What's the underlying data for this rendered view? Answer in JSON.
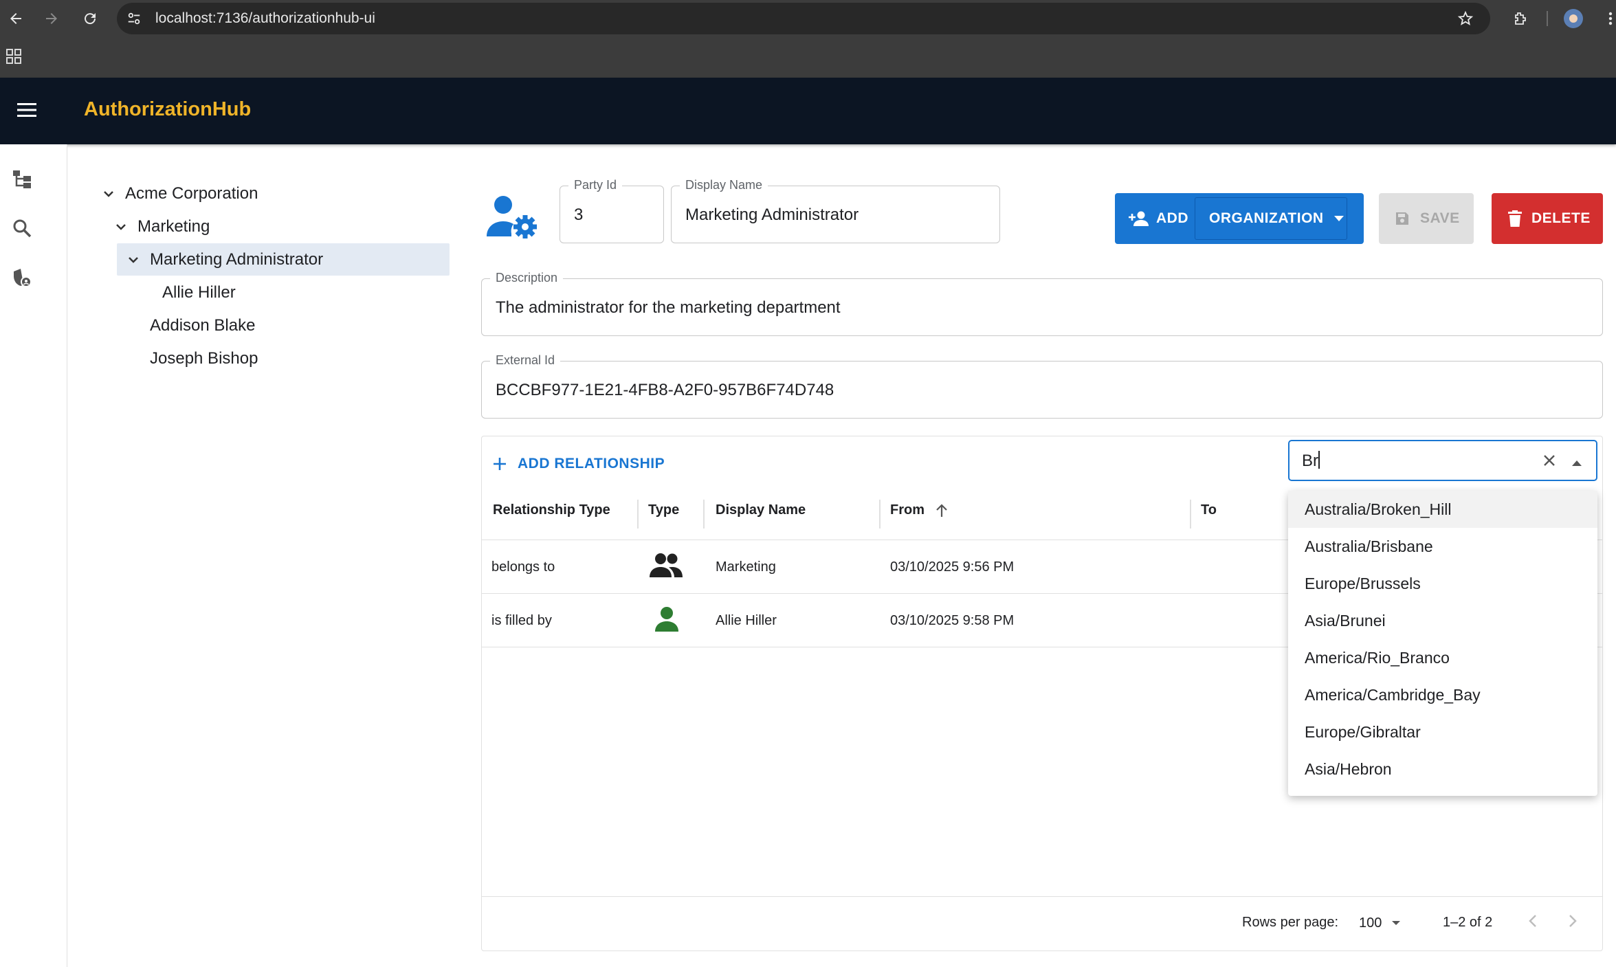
{
  "browser": {
    "url": "localhost:7136/authorizationhub-ui"
  },
  "app": {
    "title": "AuthorizationHub"
  },
  "tree": {
    "nodes": [
      {
        "label": "Acme Corporation",
        "expanded": true
      },
      {
        "label": "Marketing",
        "expanded": true
      },
      {
        "label": "Marketing Administrator",
        "expanded": true,
        "selected": true
      },
      {
        "label": "Allie Hiller"
      },
      {
        "label": "Addison Blake"
      },
      {
        "label": "Joseph Bishop"
      }
    ]
  },
  "form": {
    "party_id_label": "Party Id",
    "party_id_value": "3",
    "display_name_label": "Display Name",
    "display_name_value": "Marketing Administrator",
    "description_label": "Description",
    "description_value": "The administrator for the marketing department",
    "external_id_label": "External Id",
    "external_id_value": "BCCBF977-1E21-4FB8-A2F0-957B6F74D748"
  },
  "toolbar": {
    "add_label": "ADD",
    "organization_label": "ORGANIZATION",
    "save_label": "SAVE",
    "delete_label": "DELETE"
  },
  "relationships": {
    "add_label": "ADD RELATIONSHIP",
    "columns": [
      "Relationship Type",
      "Type",
      "Display Name",
      "From",
      "To"
    ],
    "rows": [
      {
        "relationship_type": "belongs to",
        "type_icon": "group-icon",
        "display_name": "Marketing",
        "from": "03/10/2025 9:56 PM"
      },
      {
        "relationship_type": "is filled by",
        "type_icon": "person-icon",
        "display_name": "Allie Hiller",
        "from": "03/10/2025 9:58 PM"
      }
    ],
    "footer": {
      "rows_per_page_label": "Rows per page:",
      "rows_per_page_value": "100",
      "range": "1–2 of 2"
    }
  },
  "timezone_picker": {
    "input_value": "Br",
    "options": [
      "Australia/Broken_Hill",
      "Australia/Brisbane",
      "Europe/Brussels",
      "Asia/Brunei",
      "America/Rio_Branco",
      "America/Cambridge_Bay",
      "Europe/Gibraltar",
      "Asia/Hebron"
    ]
  },
  "colors": {
    "primary": "#1976d2",
    "danger": "#d32f2f",
    "brand": "#f0b429",
    "appbar": "#0c1523",
    "group_icon": "#222222",
    "person_icon": "#2e7d32"
  }
}
